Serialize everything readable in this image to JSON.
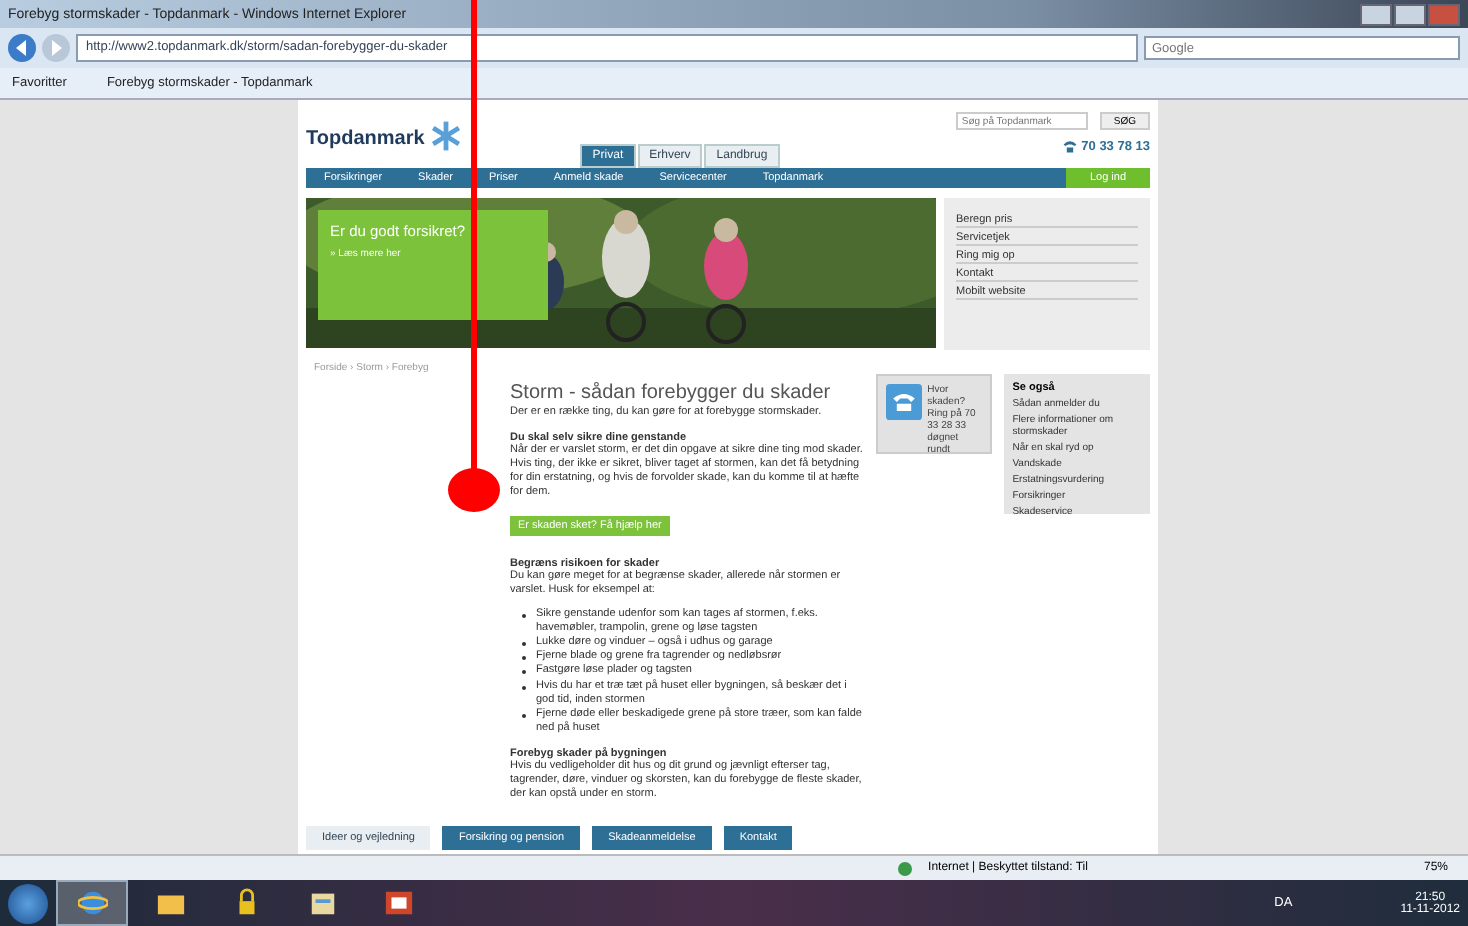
{
  "window": {
    "title": "Forebyg stormskader - Topdanmark - Windows Internet Explorer"
  },
  "address_bar": {
    "url": "http://www2.topdanmark.dk/storm/sadan-forebygger-du-skader",
    "search_placeholder": "Google"
  },
  "favorites_bar": {
    "favorites": "Favoritter",
    "tab": "Forebyg stormskader - Topdanmark"
  },
  "site": {
    "logo": "Topdanmark",
    "search_placeholder": "Søg på Topdanmark",
    "search_button": "SØG",
    "phone": "70 33 78 13",
    "tabs": [
      {
        "label": "Privat",
        "selected": true
      },
      {
        "label": "Erhverv",
        "selected": false
      },
      {
        "label": "Landbrug",
        "selected": false
      }
    ],
    "nav": [
      "Forsikringer",
      "Skader",
      "Priser",
      "Anmeld skade",
      "Servicecenter",
      "Topdanmark"
    ],
    "login": "Log ind",
    "hero": {
      "heading": "Er du godt forsikret?",
      "link": "» Læs mere her"
    },
    "quick_links": [
      "Beregn pris",
      "Servicetjek",
      "Ring mig op",
      "Kontakt",
      "Mobilt website"
    ],
    "breadcrumb": "Forside › Storm › Forebyg",
    "article": {
      "title": "Storm - sådan forebygger du skader",
      "intro": "Der er en række ting, du kan gøre for at forebygge stormskader.",
      "blocks": [
        {
          "kind": "heading",
          "text": "Du skal selv sikre dine genstande"
        },
        {
          "kind": "paragraph",
          "text": "Når der er varslet storm, er det din opgave at sikre dine ting mod skader. Hvis ting, der ikke er sikret, bliver taget af stormen, kan det få betydning for din erstatning, og hvis de forvolder skade, kan du komme til at hæfte for dem."
        },
        {
          "kind": "button",
          "text": "Er skaden sket? Få hjælp her"
        },
        {
          "kind": "heading",
          "text": "Begræns risikoen for skader"
        },
        {
          "kind": "paragraph",
          "text": "Du kan gøre meget for at begrænse skader, allerede når stormen er varslet. Husk for eksempel at:"
        },
        {
          "kind": "bullets",
          "items": [
            "Sikre genstande udenfor som kan tages af stormen, f.eks. havemøbler, trampolin, grene og løse tagsten",
            "Lukke døre og vinduer – også i udhus og garage",
            "Fjerne blade og grene fra tagrender og nedløbsrør",
            "Fastgøre løse plader og tagsten",
            "Hvis du har et træ tæt på huset eller bygningen, så beskær det i god tid, inden stormen",
            "Fjerne døde eller beskadigede grene på store træer, som kan falde ned på huset"
          ]
        },
        {
          "kind": "heading",
          "text": "Forebyg skader på bygningen"
        },
        {
          "kind": "paragraph",
          "text": "Hvis du vedligeholder dit hus og dit grund og jævnligt efterser tag, tagrender, døre, vinduer og skorsten, kan du forebygge de fleste skader, der kan opstå under en storm."
        }
      ]
    },
    "phone_box": {
      "text": "Hvor skaden? Ring på 70 33 28 33 døgnet rundt"
    },
    "see_also": {
      "title": "Se også",
      "links": [
        "Sådan anmelder du",
        "Flere informationer om stormskader",
        "Når en skal ryd op",
        "Vandskade",
        "Erstatningsvurdering",
        "Forsikringer",
        "Skadeservice"
      ]
    },
    "footer_tabs": [
      {
        "label": "Ideer og vejledning",
        "selected": false
      },
      {
        "label": "Forsikring og pension",
        "selected": true
      },
      {
        "label": "Skadeanmeldelse",
        "selected": true
      },
      {
        "label": "Kontakt",
        "selected": true
      }
    ]
  },
  "status_bar": {
    "zone": "Internet | Beskyttet tilstand: Til",
    "zoom": "75%"
  },
  "taskbar": {
    "language": "DA",
    "time": "21:50",
    "date": "11-11-2012",
    "apps": [
      {
        "kind": "ie",
        "selected": true
      },
      {
        "kind": "folder",
        "selected": false
      },
      {
        "kind": "lock",
        "selected": false
      },
      {
        "kind": "files",
        "selected": false
      },
      {
        "kind": "slides",
        "selected": false
      }
    ]
  },
  "annotation": {
    "kind": "pointer"
  }
}
